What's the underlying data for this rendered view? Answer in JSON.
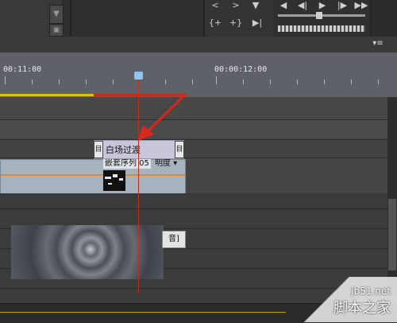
{
  "header": {
    "menu_icon_label": "▾≡"
  },
  "top_controls": {
    "row1": [
      "<",
      ">",
      "▼"
    ],
    "row2": [
      "{+",
      "+}",
      "▶|"
    ],
    "transport_row1": [
      "◀",
      "◀|",
      "▶",
      "|▶",
      "▶▶"
    ]
  },
  "timeline": {
    "time_left": "00:11:00",
    "time_right": "00:00:12:00"
  },
  "transition": {
    "label": "白场过渡",
    "left_handle": "目",
    "right_handle": "目"
  },
  "clip": {
    "name": "嵌套序列 05",
    "property": "明度 ▾"
  },
  "preview": {
    "tab_label": "音]"
  },
  "watermark": {
    "site": "jb51.net",
    "brand": "脚本之家"
  }
}
